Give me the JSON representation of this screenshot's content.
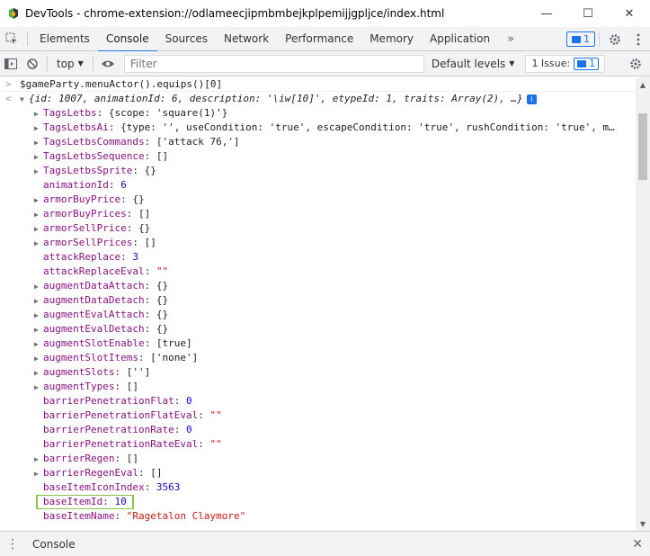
{
  "window": {
    "title": "DevTools - chrome-extension://odlameecjipmbmbejkplpemijjgpljce/index.html",
    "minimize": "—",
    "maximize": "☐",
    "close": "✕"
  },
  "tabs": [
    {
      "label": "Elements"
    },
    {
      "label": "Console"
    },
    {
      "label": "Sources"
    },
    {
      "label": "Network"
    },
    {
      "label": "Performance"
    },
    {
      "label": "Memory"
    },
    {
      "label": "Application"
    }
  ],
  "tabs_more": "»",
  "tabs_badge": "1",
  "console_toolbar": {
    "context": "top",
    "filter_placeholder": "Filter",
    "levels": "Default levels",
    "issues": "1 Issue:",
    "issues_count": "1"
  },
  "console": {
    "command": "$gameParty.menuActor().equips()[0]",
    "summary": "{id: 1007, animationId: 6, description: '\\iw[10]', etypeId: 1, traits: Array(2), …}",
    "summary_badge": "i",
    "lines": [
      {
        "expandable": true,
        "key": "TagsLetbs",
        "value": "{scope: 'square(1)'}"
      },
      {
        "expandable": true,
        "key": "TagsLetbsAi",
        "value": "{type: '', useCondition: 'true', escapeCondition: 'true', rushCondition: 'true', m…"
      },
      {
        "expandable": true,
        "key": "TagsLetbsCommands",
        "value": "['attack 76,']"
      },
      {
        "expandable": true,
        "key": "TagsLetbsSequence",
        "value": "[]"
      },
      {
        "expandable": true,
        "key": "TagsLetbsSprite",
        "value": "{}"
      },
      {
        "expandable": false,
        "key": "animationId",
        "value": "6",
        "kind": "num"
      },
      {
        "expandable": true,
        "key": "armorBuyPrice",
        "value": "{}"
      },
      {
        "expandable": true,
        "key": "armorBuyPrices",
        "value": "[]"
      },
      {
        "expandable": true,
        "key": "armorSellPrice",
        "value": "{}"
      },
      {
        "expandable": true,
        "key": "armorSellPrices",
        "value": "[]"
      },
      {
        "expandable": false,
        "key": "attackReplace",
        "value": "3",
        "kind": "num"
      },
      {
        "expandable": false,
        "key": "attackReplaceEval",
        "value": "\"\"",
        "kind": "str"
      },
      {
        "expandable": true,
        "key": "augmentDataAttach",
        "value": "{}"
      },
      {
        "expandable": true,
        "key": "augmentDataDetach",
        "value": "{}"
      },
      {
        "expandable": true,
        "key": "augmentEvalAttach",
        "value": "{}"
      },
      {
        "expandable": true,
        "key": "augmentEvalDetach",
        "value": "{}"
      },
      {
        "expandable": true,
        "key": "augmentSlotEnable",
        "value": "[true]"
      },
      {
        "expandable": true,
        "key": "augmentSlotItems",
        "value": "['none']"
      },
      {
        "expandable": true,
        "key": "augmentSlots",
        "value": "['']"
      },
      {
        "expandable": true,
        "key": "augmentTypes",
        "value": "[]"
      },
      {
        "expandable": false,
        "key": "barrierPenetrationFlat",
        "value": "0",
        "kind": "num"
      },
      {
        "expandable": false,
        "key": "barrierPenetrationFlatEval",
        "value": "\"\"",
        "kind": "str"
      },
      {
        "expandable": false,
        "key": "barrierPenetrationRate",
        "value": "0",
        "kind": "num"
      },
      {
        "expandable": false,
        "key": "barrierPenetrationRateEval",
        "value": "\"\"",
        "kind": "str"
      },
      {
        "expandable": true,
        "key": "barrierRegen",
        "value": "[]"
      },
      {
        "expandable": true,
        "key": "barrierRegenEval",
        "value": "[]"
      },
      {
        "expandable": false,
        "key": "baseItemIconIndex",
        "value": "3563",
        "kind": "num"
      },
      {
        "expandable": false,
        "key": "baseItemId",
        "value": "10",
        "kind": "num",
        "highlight": true
      },
      {
        "expandable": false,
        "key": "baseItemName",
        "value": "\"Ragetalon Claymore\"",
        "kind": "str"
      }
    ]
  },
  "drawer": {
    "tab": "Console"
  },
  "colors": {
    "accent": "#1a73e8",
    "highlight": "#8bc34a",
    "property": "#881280",
    "string": "#c41a16",
    "number": "#1c00cf"
  }
}
